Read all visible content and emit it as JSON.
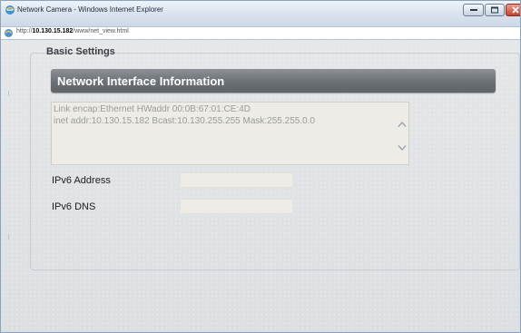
{
  "window": {
    "title": "Network Camera - Windows Internet Explorer",
    "colors": {
      "close_button": "#c4412b",
      "title_gradient_top": "#eef3fa"
    }
  },
  "address": {
    "prefix": "http://",
    "host": "10.130.15.182",
    "path": "/www/net_view.html"
  },
  "settings": {
    "legend": "Basic Settings",
    "section_title": "Network Interface Information",
    "info_lines": [
      "Link encap:Ethernet  HWaddr 00:0B:67:01:CE:4D",
      "inet addr:10.130.15.182  Bcast:10.130.255.255  Mask:255.255.0.0"
    ],
    "ipv6_label": "IPv6 Address",
    "ipv6_value": "",
    "dns_label": "IPv6 DNS",
    "dns_value": ""
  },
  "icons": {
    "browser": "ie-icon",
    "page": "page-icon",
    "minimize": "minimize-icon",
    "maximize": "maximize-icon",
    "close": "close-icon",
    "scroll_up": "chevron-up-icon",
    "scroll_down": "chevron-down-icon"
  }
}
